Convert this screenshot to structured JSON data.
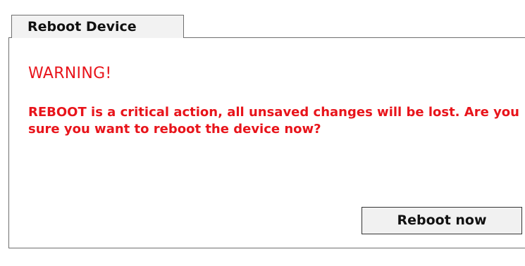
{
  "tab": {
    "label": "Reboot Device"
  },
  "warning": {
    "title": "WARNING!",
    "message": "REBOOT is a critical action, all unsaved changes will be lost. Are you sure you want to reboot the device now?"
  },
  "actions": {
    "reboot_label": "Reboot now"
  },
  "colors": {
    "warning_red": "#e8141b",
    "border_gray": "#6f6f6f",
    "button_bg": "#f1f1f1"
  }
}
